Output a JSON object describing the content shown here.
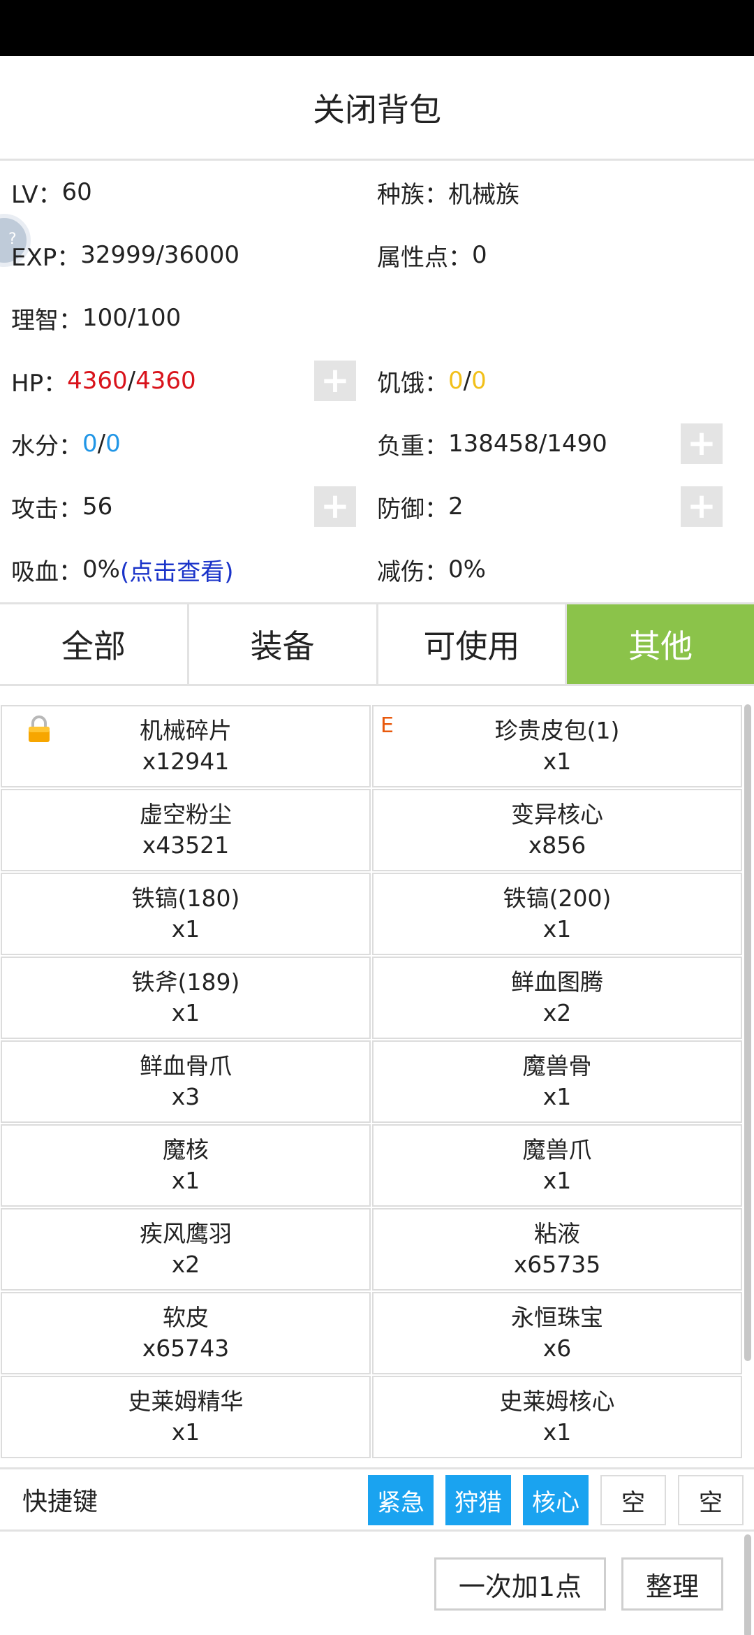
{
  "header": {
    "title": "关闭背包"
  },
  "float_button": {
    "text": "?"
  },
  "stats": {
    "lv": {
      "label": "LV：",
      "value": "60"
    },
    "race": {
      "label": "种族：",
      "value": "机械族"
    },
    "exp": {
      "label": "EXP：",
      "value": "32999/36000"
    },
    "attr_points": {
      "label": "属性点：",
      "value": "0"
    },
    "sanity": {
      "label": "理智：",
      "value": "100/100"
    },
    "hp": {
      "label": "HP：",
      "current": "4360",
      "sep": "/",
      "max": "4360"
    },
    "hunger": {
      "label": "饥饿：",
      "current": "0",
      "sep": "/",
      "max": "0"
    },
    "water": {
      "label": "水分：",
      "current": "0",
      "sep": "/",
      "max": "0"
    },
    "load": {
      "label": "负重：",
      "value": "138458/1490"
    },
    "attack": {
      "label": "攻击：",
      "value": "56"
    },
    "defense": {
      "label": "防御：",
      "value": "2"
    },
    "lifesteal": {
      "label": "吸血：",
      "value": "0%",
      "link": "(点击查看)"
    },
    "reduction": {
      "label": "减伤：",
      "value": "0%"
    },
    "plus_symbol": "+"
  },
  "tabs": [
    {
      "label": "全部"
    },
    {
      "label": "装备"
    },
    {
      "label": "可使用"
    },
    {
      "label": "其他"
    }
  ],
  "active_tab": "其他",
  "items": [
    {
      "name": "机械碎片",
      "qty": "x12941",
      "locked": true
    },
    {
      "name": "珍贵皮包(1)",
      "qty": "x1",
      "mark": "E"
    },
    {
      "name": "虚空粉尘",
      "qty": "x43521"
    },
    {
      "name": "变异核心",
      "qty": "x856"
    },
    {
      "name": "铁镐(180)",
      "qty": "x1"
    },
    {
      "name": "铁镐(200)",
      "qty": "x1"
    },
    {
      "name": "铁斧(189)",
      "qty": "x1"
    },
    {
      "name": "鲜血图腾",
      "qty": "x2"
    },
    {
      "name": "鲜血骨爪",
      "qty": "x3"
    },
    {
      "name": "魔兽骨",
      "qty": "x1"
    },
    {
      "name": "魔核",
      "qty": "x1"
    },
    {
      "name": "魔兽爪",
      "qty": "x1"
    },
    {
      "name": "疾风鹰羽",
      "qty": "x2"
    },
    {
      "name": "粘液",
      "qty": "x65735"
    },
    {
      "name": "软皮",
      "qty": "x65743"
    },
    {
      "name": "永恒珠宝",
      "qty": "x6"
    },
    {
      "name": "史莱姆精华",
      "qty": "x1"
    },
    {
      "name": "史莱姆核心",
      "qty": "x1"
    }
  ],
  "shortcut": {
    "label": "快捷键",
    "keys": [
      {
        "label": "紧急",
        "active": true
      },
      {
        "label": "狩猎",
        "active": true
      },
      {
        "label": "核心",
        "active": true
      },
      {
        "label": "空",
        "active": false
      },
      {
        "label": "空",
        "active": false
      }
    ]
  },
  "buttons": {
    "add_one": "一次加1点",
    "sort": "整理"
  },
  "colors": {
    "active_tab": "#8bc34a",
    "shortcut_active": "#1aa3f0",
    "hp": "#d9131b",
    "hunger": "#f2c01a",
    "water": "#2196e6",
    "link": "#1a33c9",
    "item_mark": "#e8590c"
  }
}
